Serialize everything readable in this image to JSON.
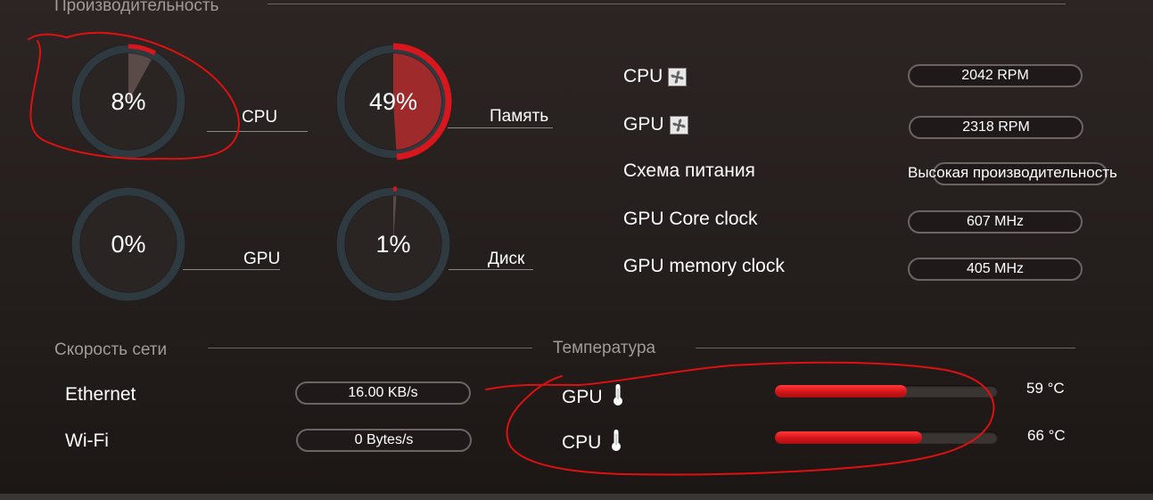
{
  "performance": {
    "title": "Производительность",
    "gauges": [
      {
        "key": "cpu",
        "value_text": "8%",
        "percent": 8,
        "label": "CPU"
      },
      {
        "key": "memory",
        "value_text": "49%",
        "percent": 49,
        "label": "Память"
      },
      {
        "key": "gpu",
        "value_text": "0%",
        "percent": 0,
        "label": "GPU"
      },
      {
        "key": "disk",
        "value_text": "1%",
        "percent": 1,
        "label": "Диск"
      }
    ]
  },
  "info": {
    "cpu_fan": {
      "label": "CPU",
      "value": "2042 RPM",
      "icon": "fan-icon"
    },
    "gpu_fan": {
      "label": "GPU",
      "value": "2318 RPM",
      "icon": "fan-icon"
    },
    "power_plan": {
      "label": "Схема питания",
      "value": "Высокая производительность"
    },
    "gpu_core_clock": {
      "label": "GPU Core clock",
      "value": "607 MHz"
    },
    "gpu_memory_clock": {
      "label": "GPU memory clock",
      "value": "405 MHz"
    }
  },
  "network": {
    "title": "Скорость сети",
    "ethernet": {
      "label": "Ethernet",
      "value": "16.00 KB/s"
    },
    "wifi": {
      "label": "Wi-Fi",
      "value": "0 Bytes/s"
    }
  },
  "temperature": {
    "title": "Температура",
    "gpu": {
      "label": "GPU",
      "value": "59 °C",
      "fill_fraction": 0.59,
      "icon": "thermometer-icon"
    },
    "cpu": {
      "label": "CPU",
      "value": "66 °C",
      "fill_fraction": 0.66,
      "icon": "thermometer-icon"
    }
  },
  "colors": {
    "accent": "#d8161b",
    "annotation": "#e01010"
  }
}
